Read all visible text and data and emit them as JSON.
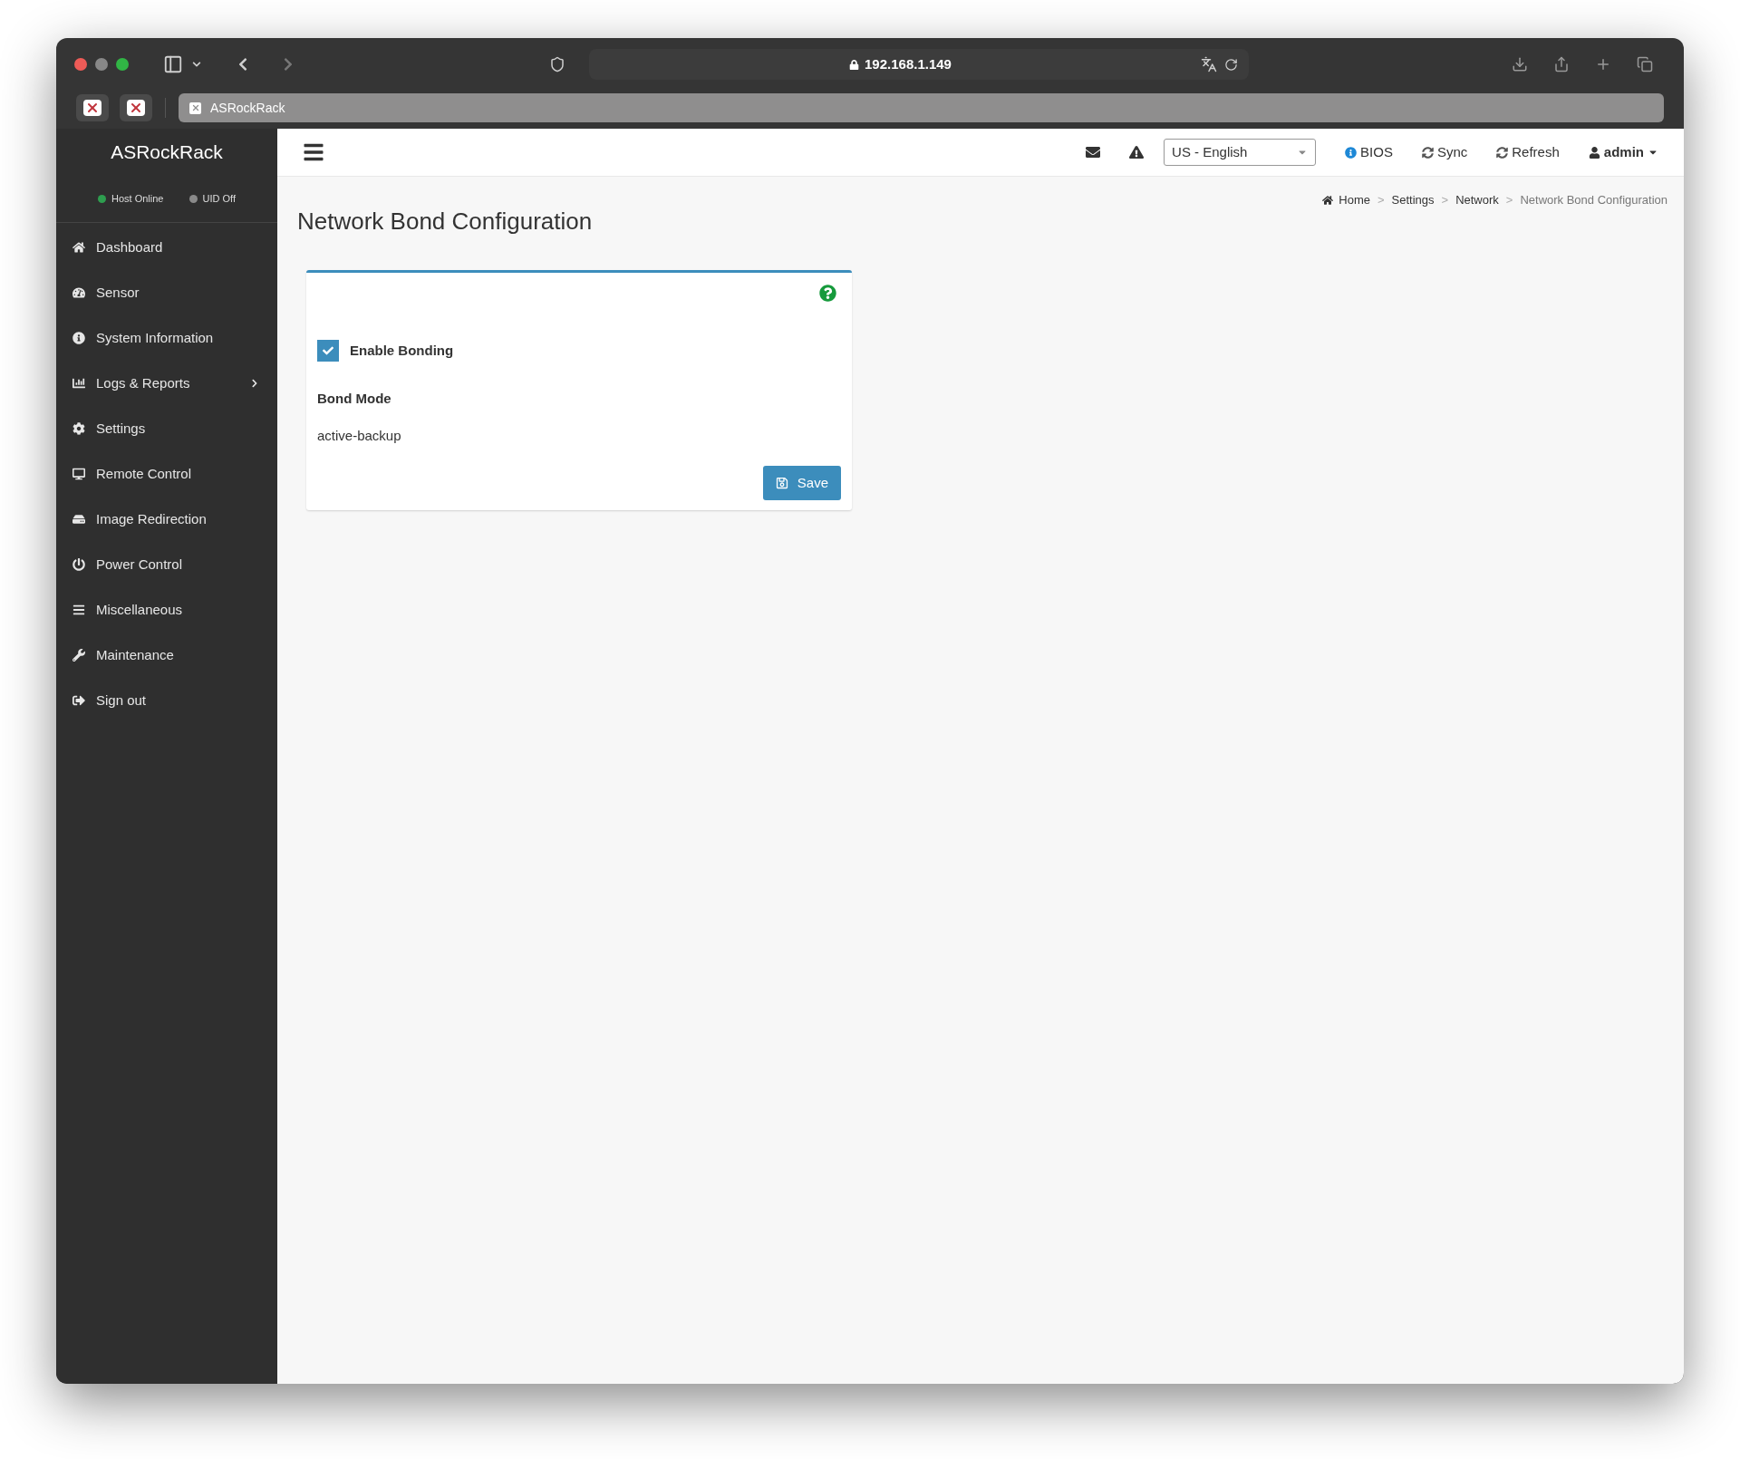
{
  "browser": {
    "url": "192.168.1.149",
    "tab_title": "ASRockRack"
  },
  "sidebar": {
    "brand": "ASRockRack",
    "status": [
      {
        "label": "Host Online",
        "color": "#2e9e4f"
      },
      {
        "label": "UID Off",
        "color": "#8a8a8a"
      }
    ],
    "items": [
      {
        "label": "Dashboard",
        "expandable": false
      },
      {
        "label": "Sensor",
        "expandable": false
      },
      {
        "label": "System Information",
        "expandable": false
      },
      {
        "label": "Logs & Reports",
        "expandable": true
      },
      {
        "label": "Settings",
        "expandable": false
      },
      {
        "label": "Remote Control",
        "expandable": false
      },
      {
        "label": "Image Redirection",
        "expandable": false
      },
      {
        "label": "Power Control",
        "expandable": false
      },
      {
        "label": "Miscellaneous",
        "expandable": false
      },
      {
        "label": "Maintenance",
        "expandable": false
      },
      {
        "label": "Sign out",
        "expandable": false
      }
    ]
  },
  "header": {
    "language": "US - English",
    "links": [
      {
        "label": "BIOS",
        "dropdown": false
      },
      {
        "label": "Sync",
        "dropdown": false
      },
      {
        "label": "Refresh",
        "dropdown": false
      },
      {
        "label": "admin",
        "dropdown": true
      }
    ]
  },
  "breadcrumb": [
    {
      "label": "Home",
      "current": false
    },
    {
      "separator": ">",
      "label": "Settings",
      "current": false
    },
    {
      "separator": ">",
      "label": "Network",
      "current": false
    },
    {
      "separator": ">",
      "label": "Network Bond Configuration",
      "current": true
    }
  ],
  "page_title": "Network Bond Configuration",
  "form": {
    "enable_bonding": {
      "label": "Enable Bonding",
      "checked": true
    },
    "bond_mode": {
      "label": "Bond Mode",
      "value": "active-backup"
    },
    "save_label": "Save"
  }
}
